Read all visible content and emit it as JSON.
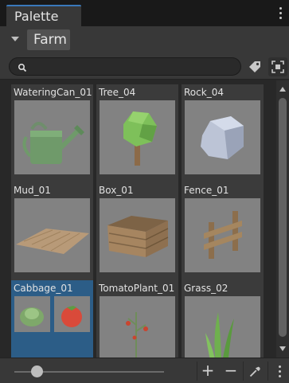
{
  "window": {
    "tab_title": "Palette"
  },
  "toolbar": {
    "palette_name": "Farm"
  },
  "search": {
    "value": "",
    "placeholder": ""
  },
  "tiles": [
    {
      "label": "WateringCan_01",
      "icon": "watering-can"
    },
    {
      "label": "Tree_04",
      "icon": "tree"
    },
    {
      "label": "Rock_04",
      "icon": "rock"
    },
    {
      "label": "Mud_01",
      "icon": "mud-plane"
    },
    {
      "label": "Box_01",
      "icon": "wooden-crate"
    },
    {
      "label": "Fence_01",
      "icon": "fence"
    },
    {
      "label": "Cabbage_01",
      "icon": "cabbage-and-tomato",
      "selected": true
    },
    {
      "label": "TomatoPlant_01",
      "icon": "tomato-plant"
    },
    {
      "label": "Grass_02",
      "icon": "grass"
    }
  ],
  "colors": {
    "accent": "#3a79bb",
    "selection": "#2c5d87"
  },
  "bottom": {
    "add_label": "+",
    "remove_label": "−",
    "zoom_level": 0.15
  }
}
